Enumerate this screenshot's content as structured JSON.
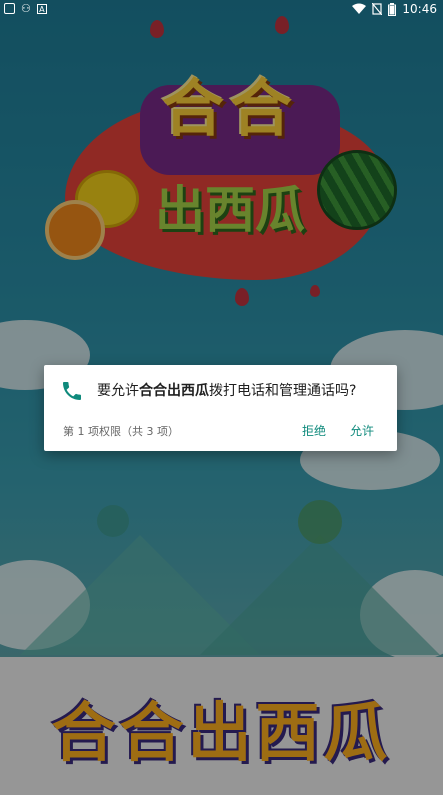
{
  "status_bar": {
    "left_icons": [
      "square-icon",
      "bug-icon",
      "a-icon"
    ],
    "right_icons": [
      "wifi-icon",
      "no-sim-icon",
      "battery-icon"
    ],
    "time": "10:46"
  },
  "game": {
    "logo_top": "合合",
    "logo_bottom": "出西瓜",
    "bottom_title": "合合出西瓜"
  },
  "permission_dialog": {
    "icon": "phone-icon",
    "message_prefix": "要允许",
    "app_name": "合合出西瓜",
    "message_suffix": "拨打电话和管理通话吗?",
    "counter": "第 1 项权限（共 3 项）",
    "deny_label": "拒绝",
    "allow_label": "允许"
  },
  "colors": {
    "accent": "#0f8a7c",
    "background_top": "#1f7f9a"
  }
}
